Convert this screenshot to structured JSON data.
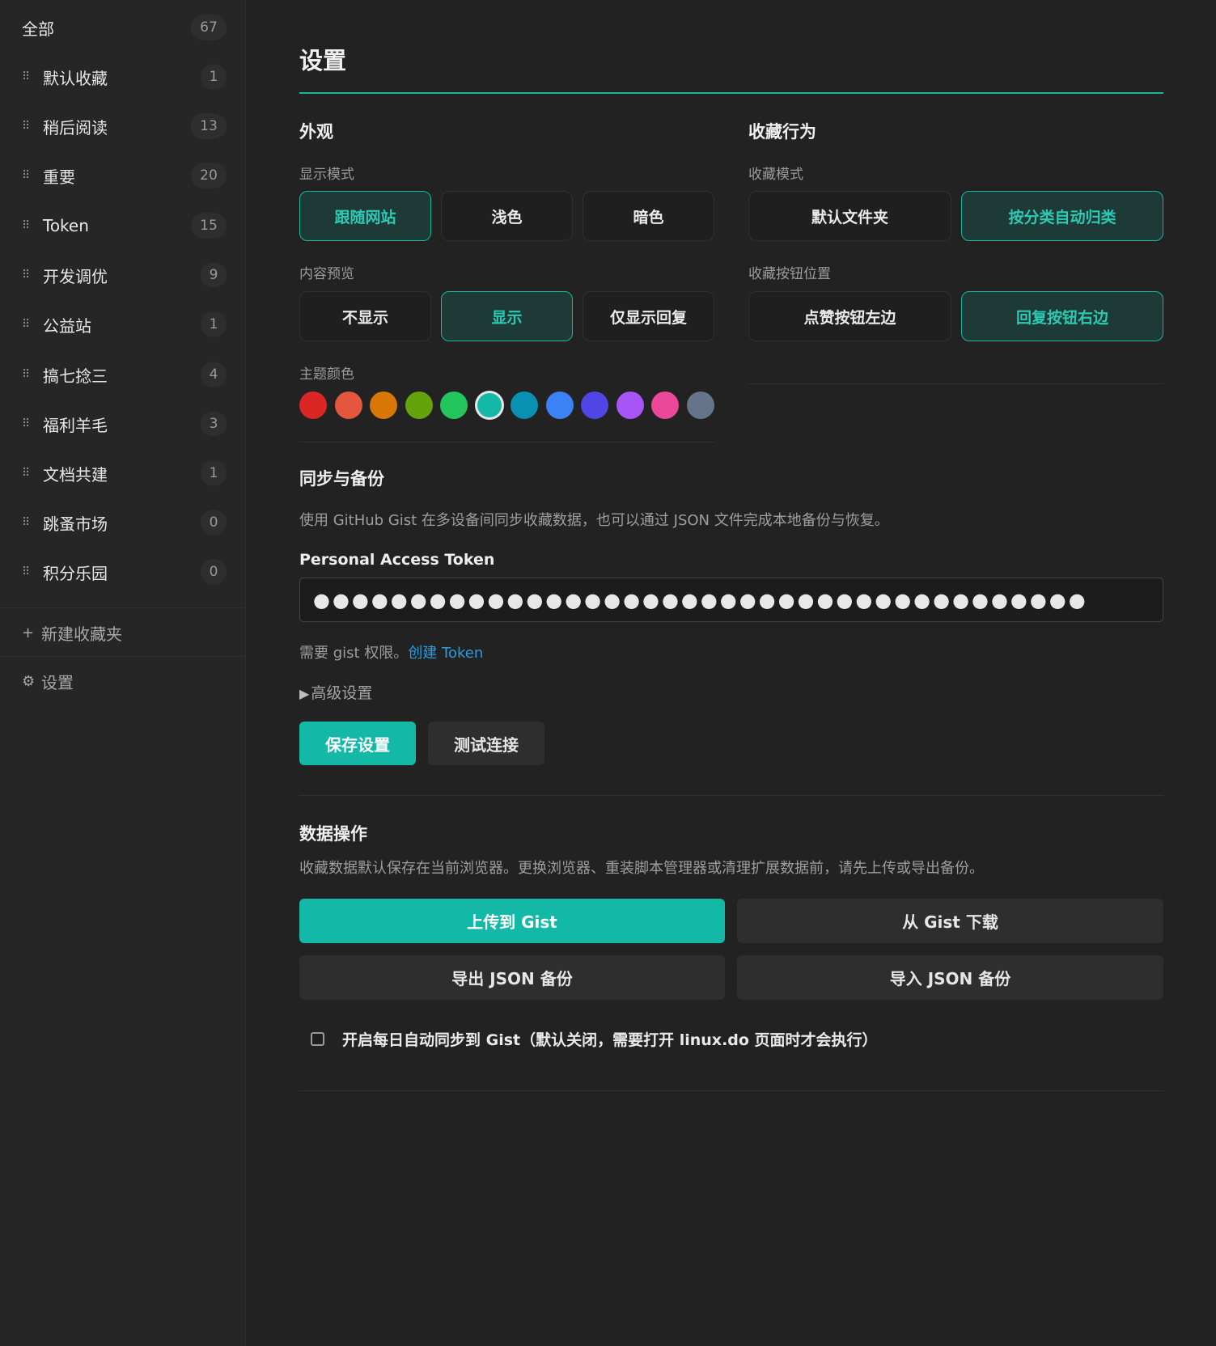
{
  "sidebar": {
    "all": {
      "label": "全部",
      "count": "67"
    },
    "items": [
      {
        "label": "默认收藏",
        "count": "1"
      },
      {
        "label": "稍后阅读",
        "count": "13"
      },
      {
        "label": "重要",
        "count": "20"
      },
      {
        "label": "Token",
        "count": "15"
      },
      {
        "label": "开发调优",
        "count": "9"
      },
      {
        "label": "公益站",
        "count": "1"
      },
      {
        "label": "搞七捻三",
        "count": "4"
      },
      {
        "label": "福利羊毛",
        "count": "3"
      },
      {
        "label": "文档共建",
        "count": "1"
      },
      {
        "label": "跳蚤市场",
        "count": "0"
      },
      {
        "label": "积分乐园",
        "count": "0"
      }
    ],
    "new_folder": "新建收藏夹",
    "new_folder_icon": "+",
    "settings": "设置",
    "settings_icon": "⚙"
  },
  "page": {
    "title": "设置"
  },
  "appearance": {
    "heading": "外观",
    "display_mode": {
      "label": "显示模式",
      "options": [
        "跟随网站",
        "浅色",
        "暗色"
      ],
      "selected": "跟随网站"
    },
    "content_preview": {
      "label": "内容预览",
      "options": [
        "不显示",
        "显示",
        "仅显示回复"
      ],
      "selected": "显示"
    },
    "theme_color": {
      "label": "主题颜色",
      "colors": [
        "#dc2626",
        "#e5563f",
        "#d97706",
        "#65a30d",
        "#22c55e",
        "#14b8a6",
        "#0891b2",
        "#3b82f6",
        "#4f46e5",
        "#a855f7",
        "#ec4899",
        "#64748b"
      ],
      "selected": "#14b8a6"
    }
  },
  "behavior": {
    "heading": "收藏行为",
    "mode": {
      "label": "收藏模式",
      "options": [
        "默认文件夹",
        "按分类自动归类"
      ],
      "selected": "按分类自动归类"
    },
    "button_position": {
      "label": "收藏按钮位置",
      "options": [
        "点赞按钮左边",
        "回复按钮右边"
      ],
      "selected": "回复按钮右边"
    }
  },
  "sync": {
    "heading": "同步与备份",
    "description": "使用 GitHub Gist 在多设备间同步收藏数据，也可以通过 JSON 文件完成本地备份与恢复。",
    "token_label": "Personal Access Token",
    "token_value": "●●●●●●●●●●●●●●●●●●●●●●●●●●●●●●●●●●●●●●●●",
    "hint_prefix": "需要 gist 权限。",
    "hint_link": "创建 Token",
    "advanced": "高级设置",
    "advanced_icon": "▶",
    "save_button": "保存设置",
    "test_button": "测试连接"
  },
  "data_ops": {
    "heading": "数据操作",
    "description": "收藏数据默认保存在当前浏览器。更换浏览器、重装脚本管理器或清理扩展数据前，请先上传或导出备份。",
    "upload": "上传到 Gist",
    "download": "从 Gist 下载",
    "export": "导出 JSON 备份",
    "import": "导入 JSON 备份",
    "auto_sync_label": "开启每日自动同步到 Gist（默认关闭，需要打开 linux.do 页面时才会执行）",
    "auto_sync_checked": false
  },
  "colors": {
    "accent": "#14b8a6",
    "background": "#222222",
    "sidebar": "#262626",
    "link": "#2b9bdf"
  }
}
